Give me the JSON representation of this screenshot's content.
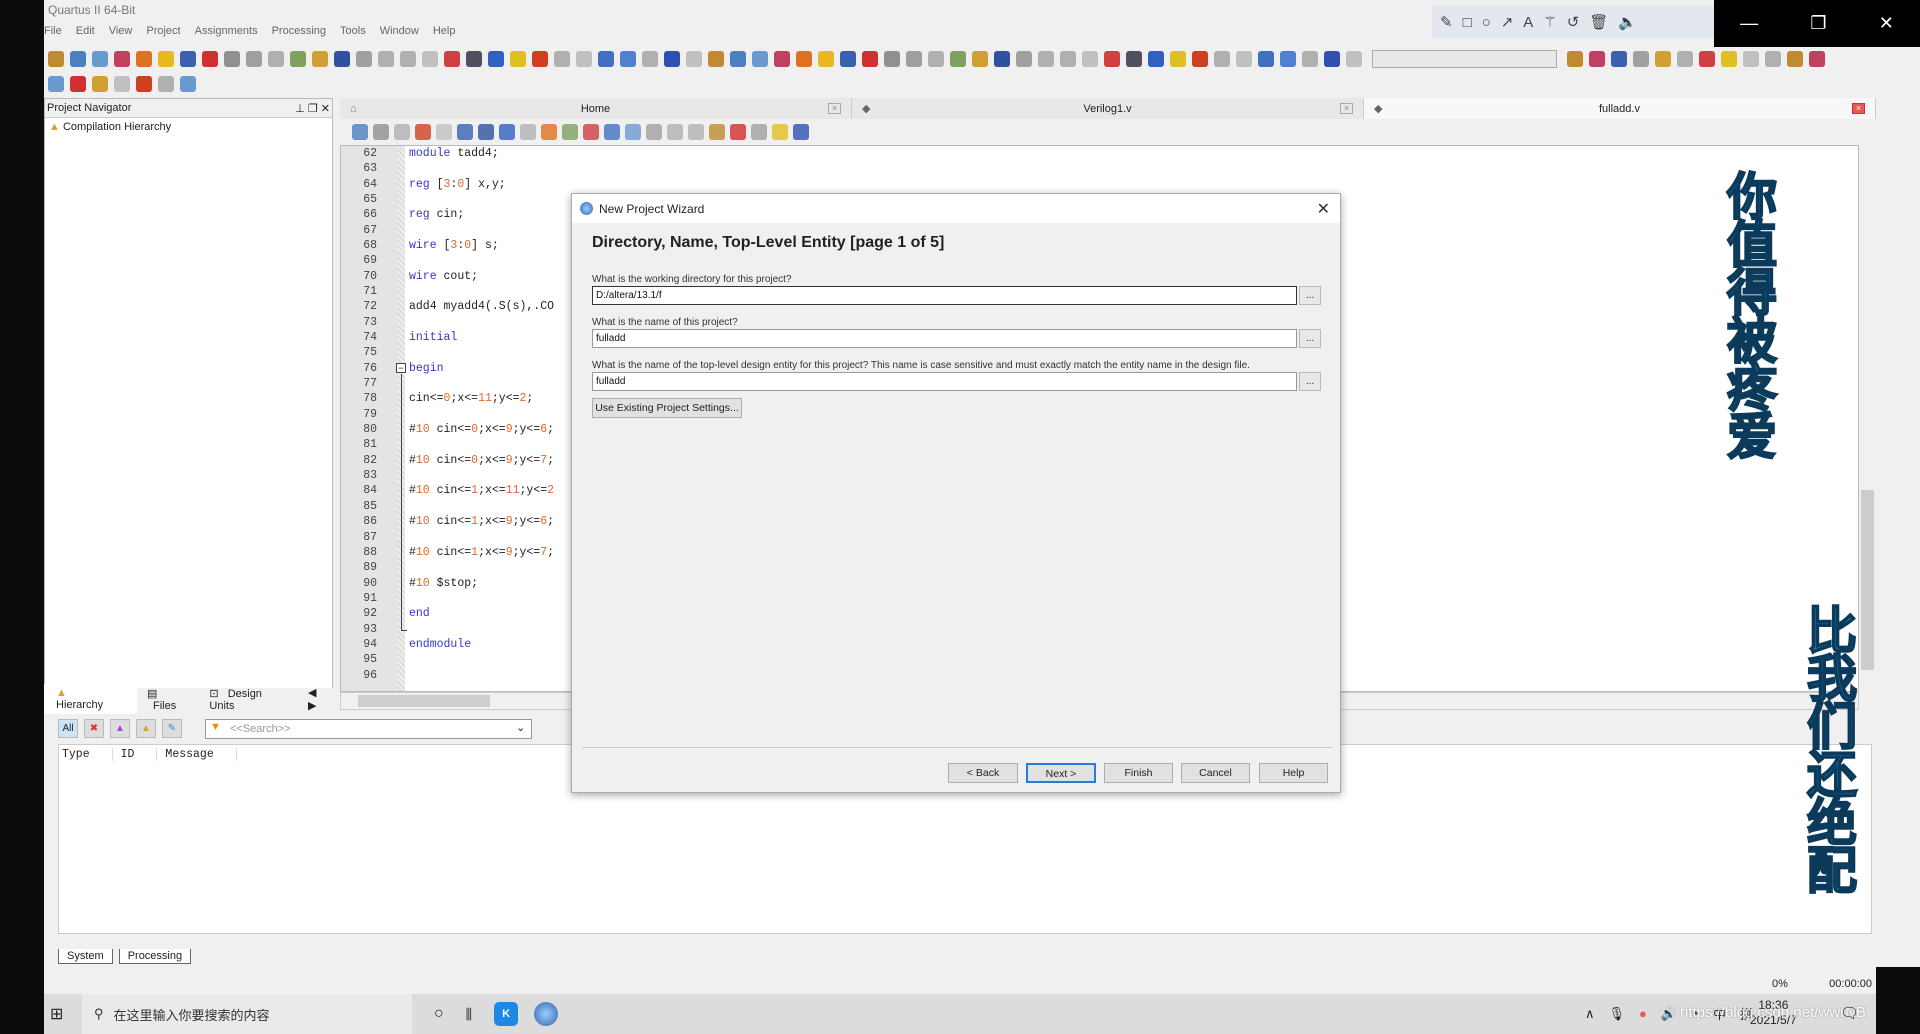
{
  "app": {
    "title": "Quartus II 64-Bit"
  },
  "menu": [
    "File",
    "Edit",
    "View",
    "Project",
    "Assignments",
    "Processing",
    "Tools",
    "Window",
    "Help"
  ],
  "draw_toolbar": [
    "pencil-icon",
    "rectangle-icon",
    "circle-icon",
    "arrow-icon",
    "text-icon",
    "magic-wand-icon",
    "undo-icon",
    "trash-icon",
    "speaker-icon"
  ],
  "window_controls": [
    "minimize",
    "restore",
    "close"
  ],
  "toolbar_colors": [
    "#c08a30",
    "#4a7fc0",
    "#6a9ad0",
    "#c04060",
    "#e07020",
    "#e8b820",
    "#3a60b0",
    "#d03030",
    "#909090",
    "#a0a0a0",
    "#b0b0b0",
    "#80a060",
    "#d0a030",
    "#3050a0",
    "#a0a0a0",
    "#b0b0b0",
    "#b0b0b0",
    "#c0c0c0",
    "#d04040",
    "#505060",
    "#3060c0",
    "#e0c020",
    "#d04020",
    "#b0b0b0",
    "#c0c0c0",
    "#4070c0",
    "#5080d0",
    "#b0b0b0",
    "#3050b0",
    "#c0c0c0"
  ],
  "nav": {
    "title": "Project Navigator",
    "item": "Compilation Hierarchy",
    "tabs": [
      "Hierarchy",
      "Files",
      "Design Units"
    ]
  },
  "editor": {
    "tabs": [
      {
        "label": "Home",
        "icon": "home-icon"
      },
      {
        "label": "Verilog1.v",
        "icon": "verilog-file-icon"
      },
      {
        "label": "fulladd.v",
        "icon": "verilog-file-icon",
        "active": true
      }
    ],
    "lines": [
      {
        "n": "62",
        "t": "module tadd4;"
      },
      {
        "n": "63",
        "t": ""
      },
      {
        "n": "64",
        "t": "reg [3:0] x,y;"
      },
      {
        "n": "65",
        "t": ""
      },
      {
        "n": "66",
        "t": "reg cin;"
      },
      {
        "n": "67",
        "t": ""
      },
      {
        "n": "68",
        "t": "wire [3:0] s;"
      },
      {
        "n": "69",
        "t": ""
      },
      {
        "n": "70",
        "t": "wire cout;"
      },
      {
        "n": "71",
        "t": ""
      },
      {
        "n": "72",
        "t": "add4 myadd4(.S(s),.CO"
      },
      {
        "n": "73",
        "t": ""
      },
      {
        "n": "74",
        "t": "initial"
      },
      {
        "n": "75",
        "t": ""
      },
      {
        "n": "76",
        "t": "begin"
      },
      {
        "n": "77",
        "t": ""
      },
      {
        "n": "78",
        "t": "cin<=0;x<=11;y<=2;"
      },
      {
        "n": "79",
        "t": ""
      },
      {
        "n": "80",
        "t": "#10 cin<=0;x<=9;y<=6;"
      },
      {
        "n": "81",
        "t": ""
      },
      {
        "n": "82",
        "t": "#10 cin<=0;x<=9;y<=7;"
      },
      {
        "n": "83",
        "t": ""
      },
      {
        "n": "84",
        "t": "#10 cin<=1;x<=11;y<=2"
      },
      {
        "n": "85",
        "t": ""
      },
      {
        "n": "86",
        "t": "#10 cin<=1;x<=9;y<=6;"
      },
      {
        "n": "87",
        "t": ""
      },
      {
        "n": "88",
        "t": "#10 cin<=1;x<=9;y<=7;"
      },
      {
        "n": "89",
        "t": ""
      },
      {
        "n": "90",
        "t": "#10 $stop;"
      },
      {
        "n": "91",
        "t": ""
      },
      {
        "n": "92",
        "t": "end"
      },
      {
        "n": "93",
        "t": ""
      },
      {
        "n": "94",
        "t": "endmodule"
      },
      {
        "n": "95",
        "t": ""
      },
      {
        "n": "96",
        "t": ""
      }
    ]
  },
  "messages": {
    "filter_all": "All",
    "search_placeholder": "<<Search>>",
    "columns": [
      "Type",
      "ID",
      "Message"
    ],
    "tabs": [
      "System",
      "Processing"
    ]
  },
  "status": {
    "progress": "0%",
    "time": "00:00:00"
  },
  "taskbar": {
    "search_placeholder": "在这里输入你要搜索的内容",
    "time": "18:36",
    "date": "2021/5/7",
    "ime": "中",
    "ime2": "拼"
  },
  "watermark": "https://blog.csdn.net/wwrNB",
  "overlay_text": [
    "你值得被疼爱",
    "比我们还绝配"
  ],
  "dialog": {
    "title": "New Project Wizard",
    "heading": "Directory, Name, Top-Level Entity [page 1 of 5]",
    "q_dir": "What is the working directory for this project?",
    "dir_value": "D:/altera/13.1/f",
    "q_name": "What is the name of this project?",
    "name_value": "fulladd",
    "q_top": "What is the name of the top-level design entity for this project? This name is case sensitive and must exactly match the entity name in the design file.",
    "top_value": "fulladd",
    "browse": "...",
    "use_existing": "Use Existing Project Settings...",
    "buttons": {
      "back": "< Back",
      "next": "Next >",
      "finish": "Finish",
      "cancel": "Cancel",
      "help": "Help"
    }
  }
}
